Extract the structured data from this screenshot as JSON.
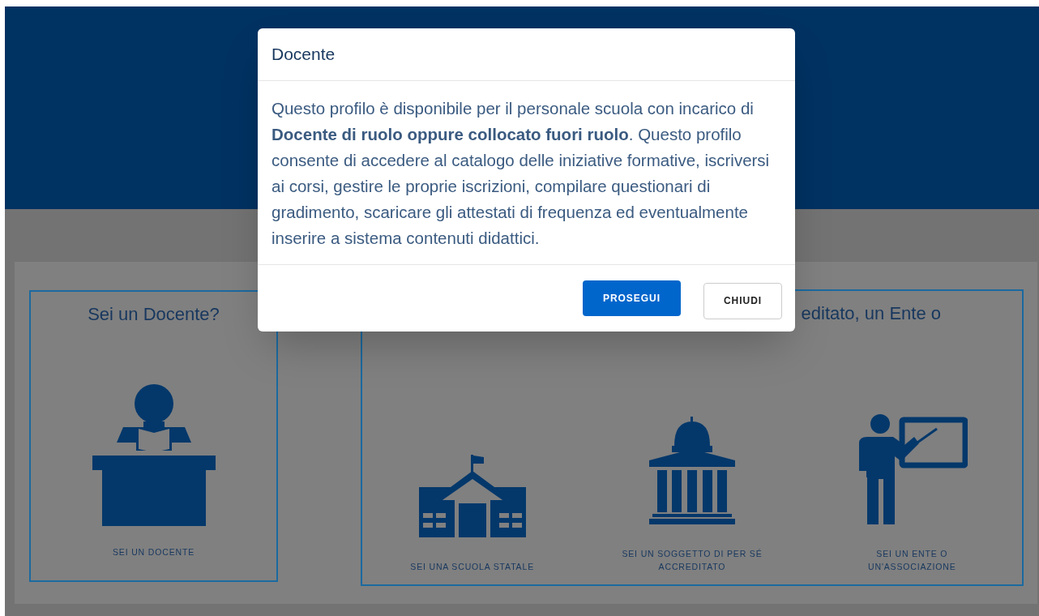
{
  "cards": [
    {
      "heading": "Sei un Docente?",
      "options": [
        {
          "label": "SEI UN DOCENTE",
          "kind": "teacher-desk"
        }
      ]
    },
    {
      "heading": "editato, un Ente o",
      "options": [
        {
          "label": "SEI UNA SCUOLA STATALE",
          "kind": "school"
        },
        {
          "label": "SEI UN SOGGETTO DI PER SÉ ACCREDITATO",
          "kind": "institution"
        },
        {
          "label": "SEI UN ENTE O UN'ASSOCIAZIONE",
          "kind": "presenter"
        }
      ]
    }
  ],
  "modal": {
    "title": "Docente",
    "body": "Questo profilo è disponibile per il personale scuola con incarico di **Docente di ruolo oppure collocato fuori ruolo**. Questo profilo consente di accedere al catalogo delle iniziative formative, iscriversi ai corsi, gestire le proprie iscrizioni, compilare questionari di gradimento, scaricare gli attestati di frequenza ed eventualmente inserire a sistema contenuti didattici.",
    "buttons": [
      {
        "label": "PROSEGUI",
        "kind": "primary"
      },
      {
        "label": "CHIUDI",
        "kind": "secondary"
      }
    ]
  }
}
